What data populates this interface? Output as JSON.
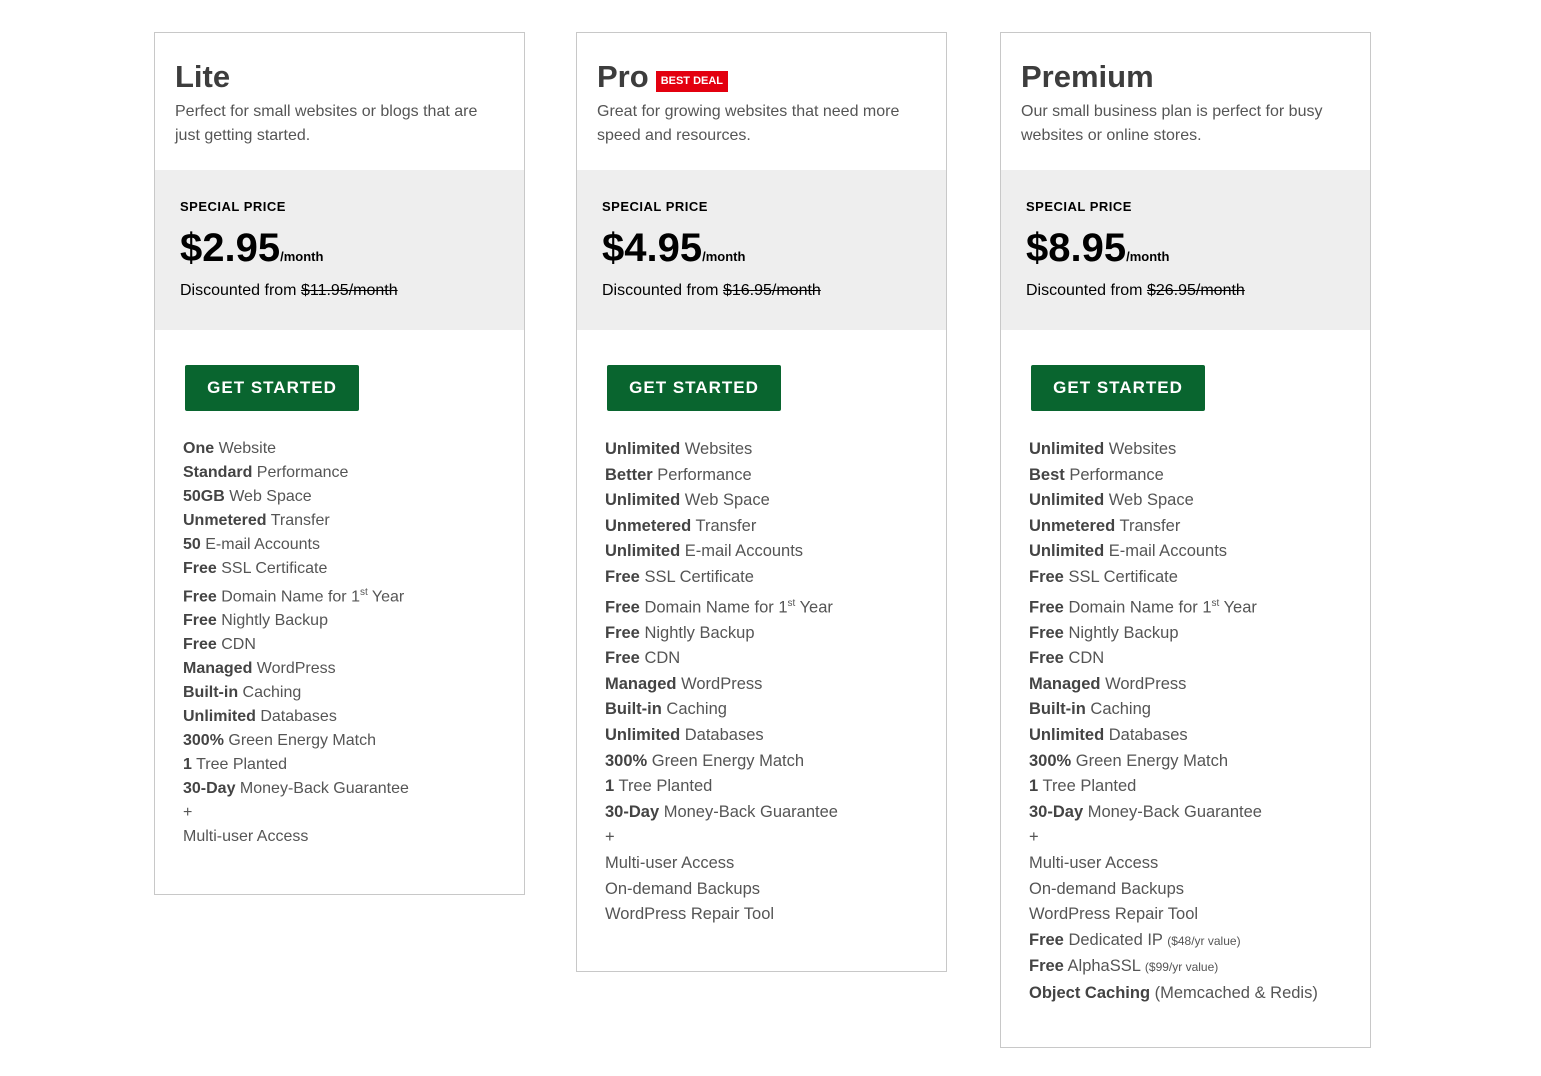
{
  "plans": [
    {
      "name": "Lite",
      "badge": "",
      "description": "Perfect for small websites or blogs that are just getting started.",
      "special_label": "SPECIAL PRICE",
      "price": "$2.95",
      "period": "/month",
      "discount_prefix": "Discounted from",
      "original_price": "$11.95/month",
      "cta": "GET STARTED",
      "features": [
        {
          "bold": "One",
          "text": " Website"
        },
        {
          "bold": "Standard",
          "text": " Performance"
        },
        {
          "bold": "50GB",
          "text": " Web Space"
        },
        {
          "bold": "Unmetered",
          "text": " Transfer"
        },
        {
          "bold": "50",
          "text": " E-mail Accounts"
        },
        {
          "bold": "Free",
          "text": " SSL Certificate"
        },
        {
          "bold": "Free",
          "text": " Domain Name for 1",
          "sup": "st",
          "after": " Year"
        },
        {
          "bold": "Free",
          "text": " Nightly Backup"
        },
        {
          "bold": "Free",
          "text": " CDN"
        },
        {
          "bold": "Managed",
          "text": " WordPress"
        },
        {
          "bold": "Built-in",
          "text": " Caching"
        },
        {
          "bold": "Unlimited",
          "text": " Databases"
        },
        {
          "bold": "300%",
          "text": " Green Energy Match"
        },
        {
          "bold": "1",
          "text": " Tree Planted"
        },
        {
          "bold": "30-Day",
          "text": " Money-Back Guarantee"
        },
        {
          "bold": "",
          "text": "+"
        },
        {
          "bold": "",
          "text": "Multi-user Access"
        }
      ]
    },
    {
      "name": "Pro",
      "badge": "BEST DEAL",
      "description": "Great for growing websites that need more speed and resources.",
      "special_label": "SPECIAL PRICE",
      "price": "$4.95",
      "period": "/month",
      "discount_prefix": "Discounted from",
      "original_price": "$16.95/month",
      "cta": "GET STARTED",
      "features": [
        {
          "bold": "Unlimited",
          "text": " Websites"
        },
        {
          "bold": "Better",
          "text": " Performance"
        },
        {
          "bold": "Unlimited",
          "text": " Web Space"
        },
        {
          "bold": "Unmetered",
          "text": " Transfer"
        },
        {
          "bold": "Unlimited",
          "text": " E-mail Accounts"
        },
        {
          "bold": "Free",
          "text": " SSL Certificate"
        },
        {
          "bold": "Free",
          "text": " Domain Name for 1",
          "sup": "st",
          "after": " Year"
        },
        {
          "bold": "Free",
          "text": " Nightly Backup"
        },
        {
          "bold": "Free",
          "text": " CDN"
        },
        {
          "bold": "Managed",
          "text": " WordPress"
        },
        {
          "bold": "Built-in",
          "text": " Caching"
        },
        {
          "bold": "Unlimited",
          "text": " Databases"
        },
        {
          "bold": "300%",
          "text": " Green Energy Match"
        },
        {
          "bold": "1",
          "text": " Tree Planted"
        },
        {
          "bold": "30-Day",
          "text": " Money-Back Guarantee"
        },
        {
          "bold": "",
          "text": "+"
        },
        {
          "bold": "",
          "text": "Multi-user Access"
        },
        {
          "bold": "",
          "text": "On-demand Backups"
        },
        {
          "bold": "",
          "text": "WordPress Repair Tool"
        }
      ]
    },
    {
      "name": "Premium",
      "badge": "",
      "description": "Our small business plan is perfect for busy websites or online stores.",
      "special_label": "SPECIAL PRICE",
      "price": "$8.95",
      "period": "/month",
      "discount_prefix": "Discounted from",
      "original_price": "$26.95/month",
      "cta": "GET STARTED",
      "features": [
        {
          "bold": "Unlimited",
          "text": " Websites"
        },
        {
          "bold": "Best",
          "text": " Performance"
        },
        {
          "bold": "Unlimited",
          "text": " Web Space"
        },
        {
          "bold": "Unmetered",
          "text": " Transfer"
        },
        {
          "bold": "Unlimited",
          "text": " E-mail Accounts"
        },
        {
          "bold": "Free",
          "text": " SSL Certificate"
        },
        {
          "bold": "Free",
          "text": " Domain Name for 1",
          "sup": "st",
          "after": " Year"
        },
        {
          "bold": "Free",
          "text": " Nightly Backup"
        },
        {
          "bold": "Free",
          "text": " CDN"
        },
        {
          "bold": "Managed",
          "text": " WordPress"
        },
        {
          "bold": "Built-in",
          "text": " Caching"
        },
        {
          "bold": "Unlimited",
          "text": " Databases"
        },
        {
          "bold": "300%",
          "text": " Green Energy Match"
        },
        {
          "bold": "1",
          "text": " Tree Planted"
        },
        {
          "bold": "30-Day",
          "text": " Money-Back Guarantee"
        },
        {
          "bold": "",
          "text": "+"
        },
        {
          "bold": "",
          "text": "Multi-user Access"
        },
        {
          "bold": "",
          "text": "On-demand Backups"
        },
        {
          "bold": "",
          "text": "WordPress Repair Tool"
        },
        {
          "bold": "Free",
          "text": " Dedicated IP ",
          "note": "($48/yr value)"
        },
        {
          "bold": "Free",
          "text": " AlphaSSL ",
          "note": "($99/yr value)"
        },
        {
          "bold": "Object Caching",
          "text": " (Memcached & Redis)"
        }
      ]
    }
  ]
}
